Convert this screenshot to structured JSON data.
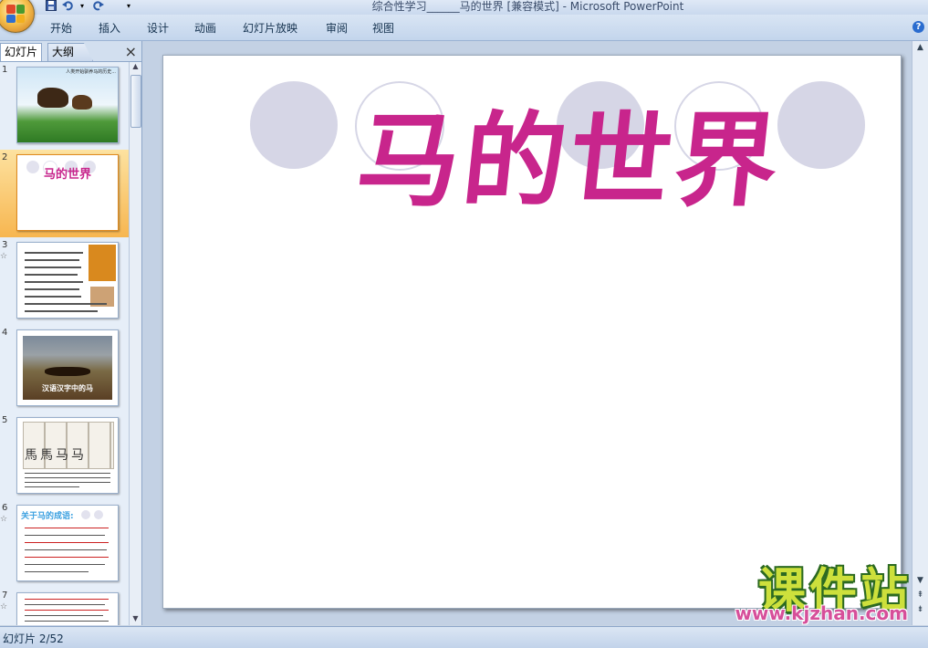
{
  "window": {
    "title": "综合性学习______马的世界 [兼容模式] - Microsoft PowerPoint"
  },
  "quick_access": {
    "save_icon": "save-icon",
    "undo_icon": "undo-icon",
    "redo_icon": "redo-icon"
  },
  "ribbon": {
    "tabs": [
      "开始",
      "插入",
      "设计",
      "动画",
      "幻灯片放映",
      "审阅",
      "视图"
    ],
    "help": "?"
  },
  "panel": {
    "tab_slides": "幻灯片",
    "tab_outline": "大纲",
    "close": "×"
  },
  "thumbnails": [
    {
      "num": "1",
      "text": "人类开始驯养马的历史...",
      "star": ""
    },
    {
      "num": "2",
      "text": "马的世界",
      "star": ""
    },
    {
      "num": "3",
      "text": "",
      "star": "☆"
    },
    {
      "num": "4",
      "text": "汉语汉字中的马",
      "star": ""
    },
    {
      "num": "5",
      "text": "",
      "star": ""
    },
    {
      "num": "6",
      "text": "关于马的成语:",
      "star": "☆"
    },
    {
      "num": "7",
      "text": "",
      "star": "☆"
    }
  ],
  "slide": {
    "title": "马的世界",
    "accent_color": "#c8258c"
  },
  "status": {
    "slide_counter": "幻灯片 2/52"
  },
  "watermark": {
    "cn": "课件站",
    "url": "www.kjzhan.com"
  }
}
